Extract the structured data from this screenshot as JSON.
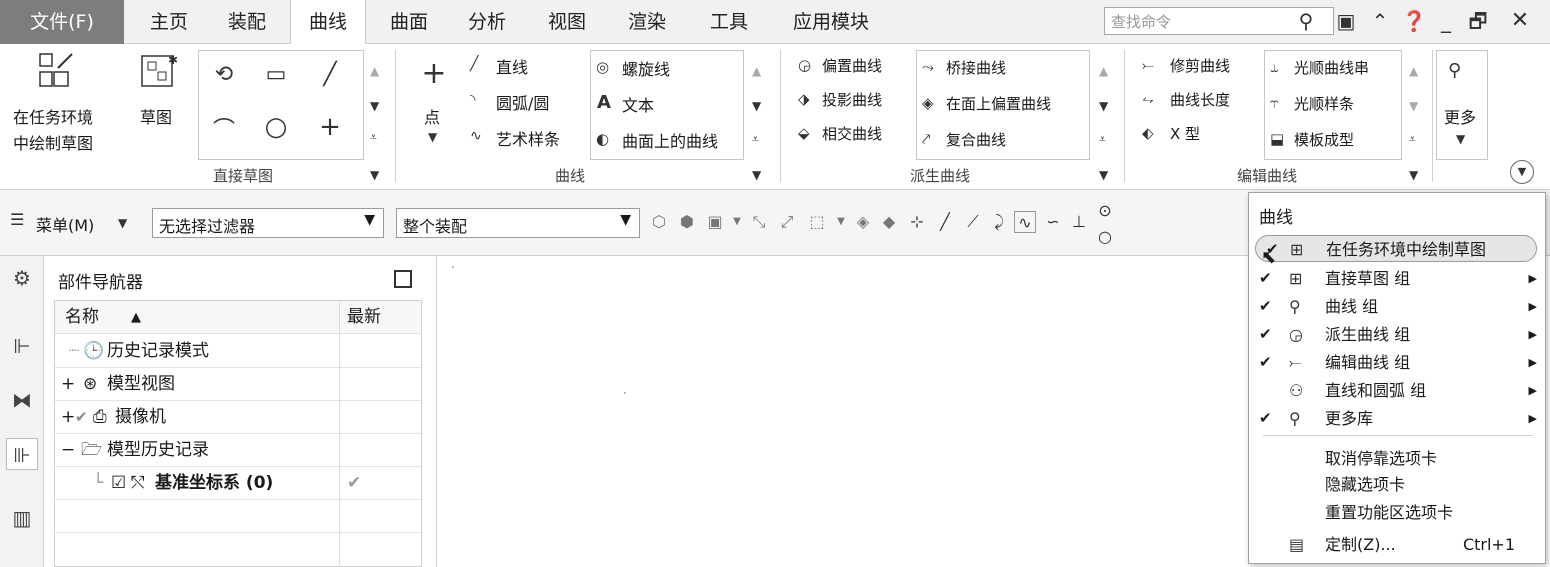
{
  "menu": {
    "tabs": [
      {
        "label": "文件(F)"
      },
      {
        "label": "主页"
      },
      {
        "label": "装配"
      },
      {
        "label": "曲线"
      },
      {
        "label": "曲面"
      },
      {
        "label": "分析"
      },
      {
        "label": "视图"
      },
      {
        "label": "渲染"
      },
      {
        "label": "工具"
      },
      {
        "label": "应用模块"
      }
    ],
    "search_placeholder": "查找命令"
  },
  "ribbon": {
    "sketch_in_task": "在任务环境中绘制草图",
    "sketch_in_task_l1": "在任务环境",
    "sketch_in_task_l2": "中绘制草图",
    "sketch": "草图",
    "direct_sketch_group": "直接草图",
    "point": "点",
    "curve_items": [
      "直线",
      "圆弧/圆",
      "艺术样条"
    ],
    "curve_items2": [
      "螺旋线",
      "文本",
      "曲面上的曲线"
    ],
    "curve_group": "曲线",
    "derived_items": [
      "偏置曲线",
      "投影曲线",
      "相交曲线"
    ],
    "derived_items2": [
      "桥接曲线",
      "在面上偏置曲线",
      "复合曲线"
    ],
    "derived_group": "派生曲线",
    "edit_items": [
      "修剪曲线",
      "曲线长度",
      "X 型"
    ],
    "edit_items2": [
      "光顺曲线串",
      "光顺样条",
      "模板成型"
    ],
    "edit_group": "编辑曲线",
    "more": "更多",
    "text_glyph": "A"
  },
  "toolbar": {
    "menu_label": "菜单(M)",
    "filter": "无选择过滤器",
    "scope": "整个装配"
  },
  "navigator": {
    "title": "部件导航器",
    "col_name": "名称",
    "col_latest": "最新",
    "rows": [
      {
        "label": "历史记录模式",
        "latest": ""
      },
      {
        "label": "模型视图",
        "latest": ""
      },
      {
        "label": "摄像机",
        "latest": ""
      },
      {
        "label": "模型历史记录",
        "latest": ""
      },
      {
        "label": "基准坐标系 (0)",
        "latest": "✔"
      }
    ]
  },
  "popup": {
    "title": "曲线",
    "items": [
      {
        "label": "在任务环境中绘制草图",
        "checked": "✔"
      },
      {
        "label": "直接草图 组",
        "checked": "✔"
      },
      {
        "label": "曲线 组",
        "checked": "✔"
      },
      {
        "label": "派生曲线 组",
        "checked": "✔"
      },
      {
        "label": "编辑曲线 组",
        "checked": "✔"
      },
      {
        "label": "直线和圆弧 组",
        "checked": ""
      },
      {
        "label": "更多库",
        "checked": "✔"
      }
    ],
    "actions": [
      "取消停靠选项卡",
      "隐藏选项卡",
      "重置功能区选项卡"
    ],
    "customize": "定制(Z)...",
    "customize_shortcut": "Ctrl+1"
  }
}
